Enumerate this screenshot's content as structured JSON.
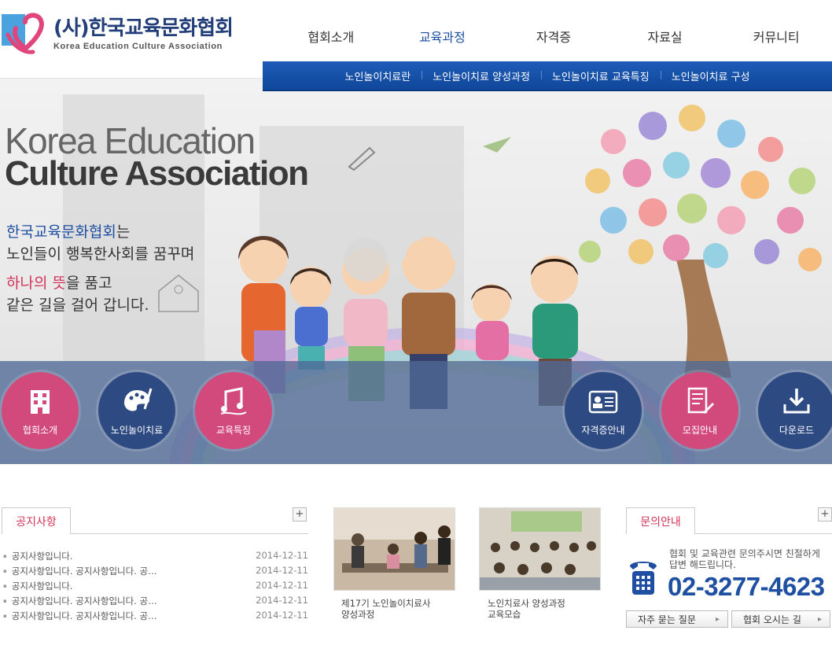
{
  "header": {
    "logo_ko": "(사)한국교육문화협회",
    "logo_en": "Korea Education Culture Association",
    "nav": [
      "협회소개",
      "교육과정",
      "자격증",
      "자료실",
      "커뮤니티"
    ],
    "active_nav_index": 1,
    "subnav": [
      "노인놀이치료란",
      "노인놀이치료 양성과정",
      "노인놀이치료 교육특징",
      "노인놀이치료 구성"
    ]
  },
  "hero": {
    "title_line1": "Korea Education",
    "title_line2": "Culture Association",
    "text_line1_highlight": "한국교육문화협회",
    "text_line1_rest": "는",
    "text_line2": "노인들이 행복한사회를 꿈꾸며",
    "text_line3_highlight": "하나의 뜻",
    "text_line3_rest": "을 품고",
    "text_line4": "같은 길을 걸어 갑니다."
  },
  "quick_links": [
    {
      "label": "협회소개",
      "icon": "building-icon",
      "color": "#d24a7c"
    },
    {
      "label": "노인놀이치료",
      "icon": "palette-icon",
      "color": "#2d4a82"
    },
    {
      "label": "교육특징",
      "icon": "music-icon",
      "color": "#d24a7c"
    },
    {
      "label": "자격증안내",
      "icon": "id-card-icon",
      "color": "#2d4a82"
    },
    {
      "label": "모집안내",
      "icon": "document-pen-icon",
      "color": "#d24a7c"
    },
    {
      "label": "다운로드",
      "icon": "download-icon",
      "color": "#2d4a82"
    }
  ],
  "notice": {
    "tab_label": "공지사항",
    "more": "+",
    "items": [
      {
        "title": "공지사항입니다.",
        "date": "2014-12-11"
      },
      {
        "title": "공지사항입니다. 공지사항입니다. 공…",
        "date": "2014-12-11"
      },
      {
        "title": "공지사항입니다.",
        "date": "2014-12-11"
      },
      {
        "title": "공지사항입니다. 공지사항입니다. 공…",
        "date": "2014-12-11"
      },
      {
        "title": "공지사항입니다. 공지사항입니다. 공…",
        "date": "2014-12-11"
      }
    ]
  },
  "gallery": [
    {
      "caption_line1": "제17기 노인놀이치료사",
      "caption_line2": "양성과정"
    },
    {
      "caption_line1": "노인치료사 양성과정",
      "caption_line2": "교육모습"
    }
  ],
  "inquiry": {
    "tab_label": "문의안내",
    "more": "+",
    "text": "협회 및 교육관련 문의주시면 친절하게 답변 해드립니다.",
    "phone": "02-3277-4623",
    "btn_faq": "자주 묻는 질문",
    "btn_map": "협회 오시는 길"
  },
  "colors": {
    "brand_blue": "#1e4fa2",
    "brand_pink": "#d3335a",
    "navy": "#2d4a82"
  }
}
